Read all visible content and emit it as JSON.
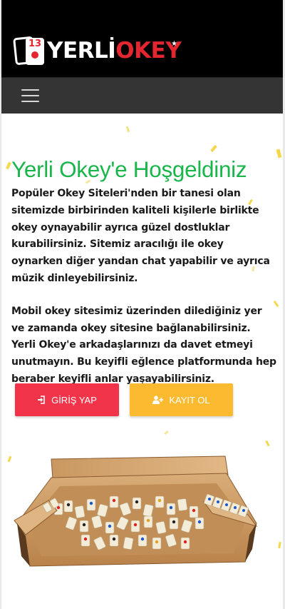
{
  "header": {
    "logo": {
      "card_number": "13",
      "text_part1": "YERLİ",
      "text_part2": "OKEY"
    }
  },
  "nav": {
    "menu_icon": "hamburger-menu-icon"
  },
  "hero": {
    "title": "Yerli Okey'e Hoşgeldiniz",
    "paragraph1": "Popüler Okey Siteleri'nden bir tanesi olan sitemizde birbirinden kaliteli kişilerle birlikte okey oynayabilir ayrıca güzel dostluklar kurabilirsiniz. Sitemiz aracılığı ile okey oynarken diğer yandan chat yapabilir ve ayrıca müzik dinleyebilirsiniz.",
    "paragraph2": "Mobil okey sitesimiz üzerinden dilediğiniz yer ve zamanda okey sitesine bağlanabilirsiniz. Yerli Okey'e arkadaşlarınızı da davet etmeyi unutmayın. Bu keyifli eğlence platformunda hep beraber keyifli anlar yaşayabilirsiniz.",
    "login_button": "GİRİŞ YAP",
    "register_button": "KAYIT OL",
    "login_icon": "sign-in-icon",
    "register_icon": "user-plus-icon"
  },
  "colors": {
    "header_bg": "#000000",
    "nav_bg": "#343434",
    "title_green": "#1ab64b",
    "login_red": "#f2344a",
    "register_yellow": "#fbba2f",
    "logo_red": "#e3262f"
  }
}
